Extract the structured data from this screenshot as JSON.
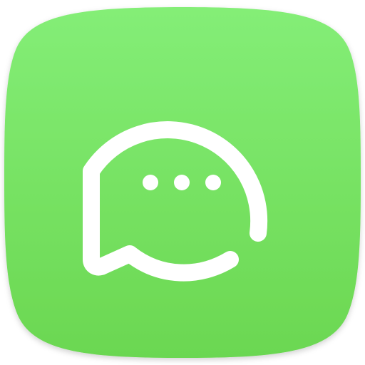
{
  "app_icon": {
    "icon": "messages-icon",
    "glyph": "chat-bubble-typing-icon",
    "colors": {
      "squircle_top": "#84EE77",
      "squircle_bottom": "#6BD751",
      "glyph": "#FFFFFF"
    }
  }
}
